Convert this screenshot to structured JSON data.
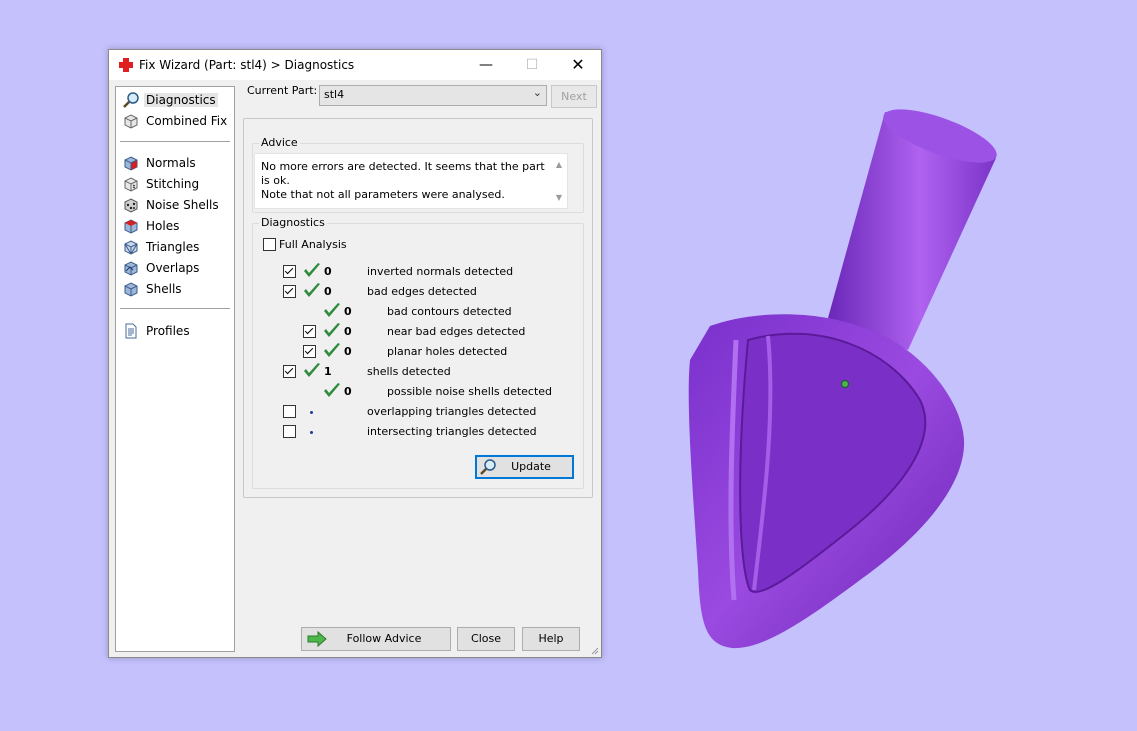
{
  "window": {
    "title": "Fix Wizard (Part: stl4) > Diagnostics",
    "controls": {
      "minimize": "—",
      "maximize": "☐",
      "close": "✕"
    }
  },
  "sidebar": {
    "groups": [
      [
        {
          "label": "Diagnostics",
          "icon": "magnifier-icon",
          "selected": true
        },
        {
          "label": "Combined Fix",
          "icon": "cube-icon"
        }
      ],
      [
        {
          "label": "Normals",
          "icon": "normals-cube-icon"
        },
        {
          "label": "Stitching",
          "icon": "stitching-cube-icon"
        },
        {
          "label": "Noise Shells",
          "icon": "noise-shells-icon"
        },
        {
          "label": "Holes",
          "icon": "holes-cube-icon"
        },
        {
          "label": "Triangles",
          "icon": "triangles-cube-icon"
        },
        {
          "label": "Overlaps",
          "icon": "overlaps-cube-icon"
        },
        {
          "label": "Shells",
          "icon": "shells-cube-icon"
        }
      ],
      [
        {
          "label": "Profiles",
          "icon": "document-icon"
        }
      ]
    ]
  },
  "current_part": {
    "label": "Current Part:",
    "value": "stl4",
    "next_label": "Next"
  },
  "advice": {
    "title": "Advice",
    "text_line1": "No more errors are detected. It seems that the part is ok.",
    "text_line2": "Note that not all parameters were analysed."
  },
  "diagnostics": {
    "title": "Diagnostics",
    "full_analysis_label": "Full Analysis",
    "full_analysis_checked": false,
    "rows": [
      {
        "checkbox": true,
        "checked": true,
        "status": "ok",
        "count": "0",
        "desc": "inverted normals detected",
        "indent": 0
      },
      {
        "checkbox": true,
        "checked": true,
        "status": "ok",
        "count": "0",
        "desc": "bad edges detected",
        "indent": 0
      },
      {
        "checkbox": false,
        "checked": false,
        "status": "ok",
        "count": "0",
        "desc": "bad contours detected",
        "indent": 1
      },
      {
        "checkbox": true,
        "checked": true,
        "status": "ok",
        "count": "0",
        "desc": "near bad edges detected",
        "indent": 1
      },
      {
        "checkbox": true,
        "checked": true,
        "status": "ok",
        "count": "0",
        "desc": "planar holes detected",
        "indent": 1
      },
      {
        "checkbox": true,
        "checked": true,
        "status": "ok",
        "count": "1",
        "desc": "shells detected",
        "indent": 0
      },
      {
        "checkbox": false,
        "checked": false,
        "status": "ok",
        "count": "0",
        "desc": "possible noise shells detected",
        "indent": 1
      },
      {
        "checkbox": true,
        "checked": false,
        "status": "none",
        "count": "",
        "desc": "overlapping triangles detected",
        "indent": 0
      },
      {
        "checkbox": true,
        "checked": false,
        "status": "none",
        "count": "",
        "desc": "intersecting triangles detected",
        "indent": 0
      }
    ],
    "update_label": "Update"
  },
  "footer": {
    "follow_advice": "Follow Advice",
    "close": "Close",
    "help": "Help"
  },
  "colors": {
    "background": "#c4c1fd",
    "model": "#8a3fd4",
    "check": "#2e8b3e",
    "accent": "#0078d7"
  }
}
